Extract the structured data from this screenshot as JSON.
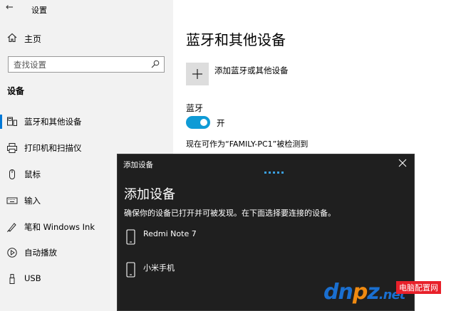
{
  "app": {
    "title": "设置",
    "back_icon": "back-arrow-icon"
  },
  "sidebar": {
    "home_label": "主页",
    "search_placeholder": "查找设置",
    "section_title": "设备",
    "items": [
      {
        "label": "蓝牙和其他设备",
        "icon": "bluetooth-devices-icon",
        "active": true
      },
      {
        "label": "打印机和扫描仪",
        "icon": "printer-icon",
        "active": false
      },
      {
        "label": "鼠标",
        "icon": "mouse-icon",
        "active": false
      },
      {
        "label": "输入",
        "icon": "keyboard-icon",
        "active": false
      },
      {
        "label": "笔和 Windows Ink",
        "icon": "pen-icon",
        "active": false
      },
      {
        "label": "自动播放",
        "icon": "autoplay-icon",
        "active": false
      },
      {
        "label": "USB",
        "icon": "usb-icon",
        "active": false
      }
    ]
  },
  "main": {
    "title": "蓝牙和其他设备",
    "add_device_label": "添加蓝牙或其他设备",
    "bluetooth_title": "蓝牙",
    "bluetooth_state": "开",
    "bluetooth_on": true,
    "discoverable_text": "现在可作为“FAMILY-PC1”被检测到"
  },
  "dialog": {
    "bar_title": "添加设备",
    "title": "添加设备",
    "description": "确保你的设备已打开并可被发现。在下面选择要连接的设备。",
    "devices": [
      {
        "name": "Redmi Note 7",
        "icon": "phone-icon"
      },
      {
        "name": "小米手机",
        "icon": "phone-icon"
      }
    ]
  },
  "watermark": {
    "text_main": "dnpz.net",
    "badge": "电脑配置网"
  },
  "colors": {
    "accent": "#0078d7",
    "toggle": "#0f9bd6",
    "dialog_bg": "#1f1f1f",
    "sidebar_bg": "#f2f2f2"
  }
}
